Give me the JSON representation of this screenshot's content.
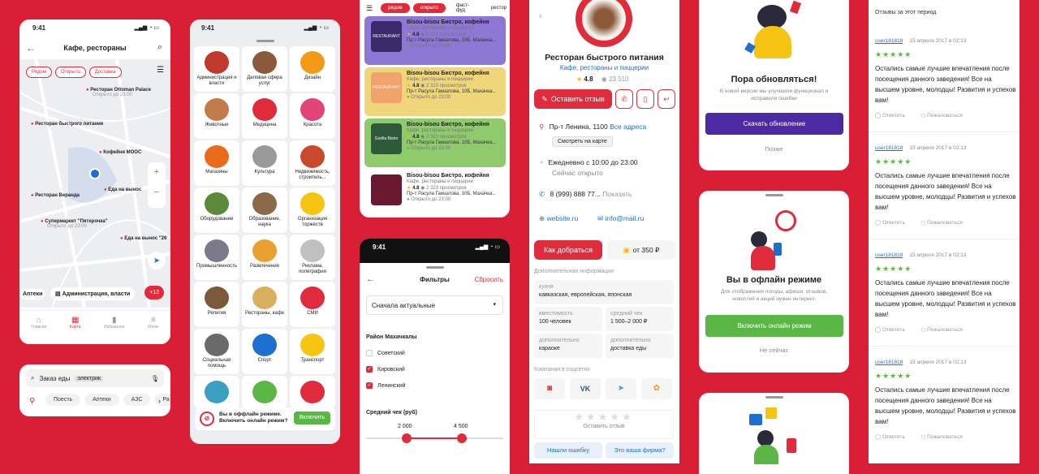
{
  "map": {
    "time": "9:41",
    "title": "Кафе, рестораны",
    "chips": [
      "Рядом",
      "Открыто",
      "Доставка"
    ],
    "pins": [
      {
        "name": "Ресторан Ottoman Palace",
        "sub": "Открыто до 23:00"
      },
      {
        "name": "Ресторан быстрого питания"
      },
      {
        "name": "Кофейня МООС"
      },
      {
        "name": "Еда на вынос"
      },
      {
        "name": "Ресторан Веранда"
      },
      {
        "name": "Супермаркет \"Пятерочка\"",
        "sub": "Открыто до 23:00"
      },
      {
        "name": "Еда на вынос \"26"
      }
    ],
    "bottom_chips": [
      "Аптеки",
      "Администрация, власти",
      "+12"
    ],
    "tabs": [
      "Главная",
      "Карта",
      "Избранное",
      "Меню"
    ]
  },
  "search": {
    "text": "Заказ еды",
    "tag": "электрик",
    "quick": [
      "Поесть",
      "Аптеки",
      "АЗС",
      "Ра"
    ]
  },
  "cats": {
    "time": "9:41",
    "items": [
      "Администрация и власти",
      "Деловая сфера услуг",
      "Дизайн",
      "Животные",
      "Медицина",
      "Красота",
      "Магазины",
      "Культура",
      "Недвижимость, строитель...",
      "Оборудование",
      "Образование, наука",
      "Организация торжеств",
      "Промышленность",
      "Развлечения",
      "Реклама, полиграфия",
      "Религия",
      "Рестораны, кафе",
      "СМИ",
      "Социальная помощь",
      "Спорт",
      "Транспорт"
    ],
    "offline": "Вы в оффлайн режиме. Включить онлайн режим?",
    "offline_btn": "Включить"
  },
  "list": {
    "filters": [
      "рядом",
      "открыто",
      "фаст-фуд",
      "рестор"
    ],
    "items": [
      {
        "title": "Bisou-bisou Бистро, кофейня",
        "sub": "Кафе, рестораны и пиццерии",
        "rating": "4.8",
        "views": "2 323 просмотров",
        "addr": "Пр-т Расула Гамзатова, 10Б, Махачка...",
        "open": "Открыто до 23:00",
        "color": "#8f77d6",
        "logo": "#3a2a6a",
        "logo_text": "RESTAURANT"
      },
      {
        "title": "Bisou-bisou Бистро, кофейня",
        "sub": "Кафе, рестораны и пиццерии",
        "rating": "4.8",
        "views": "2 323 просмотров",
        "addr": "Пр-т Расула Гамзатова, 10Б, Махачка...",
        "open": "Открыто до 23:00",
        "color": "#f0d67a",
        "logo": "#f2a36b",
        "logo_text": "RESTAURANT"
      },
      {
        "title": "Bisou-bisou Бистро, кофейня",
        "sub": "Кафе, рестораны и пиццерии",
        "rating": "4.8",
        "views": "2 323 просмотров",
        "addr": "Пр-т Расула Гамзатова, 10Б, Махачка...",
        "open": "Открыто до 23:00",
        "color": "#8fca6c",
        "logo": "#2f5a3a",
        "logo_text": "Gorilla Bistro"
      },
      {
        "title": "Bisou-bisou Бистро, кофейня",
        "sub": "Кафе, рестораны и пиццерии",
        "rating": "4.8",
        "views": "2 323 просмотров",
        "addr": "Пр-т Расула Гамзатова, 10Б, Махачка...",
        "open": "Открыто до 23:00",
        "color": "#ffffff",
        "logo": "#6a1830",
        "logo_text": ""
      }
    ]
  },
  "filters": {
    "time": "9:41",
    "title": "Фильтры",
    "reset": "Сбросить",
    "sort": "Сначала актуальные",
    "district_label": "Район Махачкалы",
    "districts": [
      {
        "name": "Советский",
        "checked": false
      },
      {
        "name": "Кировский",
        "checked": true
      },
      {
        "name": "Ленинский",
        "checked": true
      }
    ],
    "check_label": "Средний чек (руб)",
    "min": "2 000",
    "max": "4 500"
  },
  "detail": {
    "title": "Ресторан быстрого питания",
    "category": "Кафе, рестораны и пиццерии",
    "rating": "4.8",
    "views": "23 510",
    "review_btn": "Оставить отзыв",
    "address": "Пр-т Ленина, 1100",
    "all_addr": "Все адреса",
    "map_btn": "Смотреть на карте",
    "hours": "Ежедневно с 10:00 до 23:00",
    "open_now": "Сейчас открыто",
    "phone": "8 (999) 888 77...",
    "show": "Показать",
    "site": "website.ru",
    "email": "info@mail.ru",
    "route": "Как добраться",
    "price": "от 350 ₽",
    "add_info": "Дополнительная информация",
    "fields": [
      {
        "k": "кухня",
        "v": "кавказская, европейская, японская"
      },
      {
        "k": "вместимость",
        "v": "100 человек"
      },
      {
        "k": "средний чек",
        "v": "1 500–2 000 ₽"
      },
      {
        "k": "дополнительно",
        "v": "караоке"
      },
      {
        "k": "дополнительно",
        "v": "доставка еды"
      }
    ],
    "social": "Компания в соцсетях",
    "leave_review": "Оставить отзыв",
    "error": "Нашли ошибку",
    "owner": "Это ваша фирма?"
  },
  "update": {
    "title": "Пора обновляться!",
    "text": "В новой версии мы улучшили функционал и исправили ошибки",
    "btn": "Скачать обновление",
    "later": "Позже"
  },
  "offline": {
    "title": "Вы в офлайн режиме",
    "text": "Для отображения погоды, афиши, отзывов, новостей и акций нужен интернет.",
    "btn": "Включить онлайн режим",
    "not_now": "Не сейчас"
  },
  "reviews": {
    "header": "Отзывы за этот период",
    "items": [
      {
        "user": "user181818",
        "date": "15 апреля 2017 в 02:13",
        "text": "Остались самые лучшие впечатления после посещения данного заведения! Все на высшем уровне, молодцы! Развития и успехов вам!"
      },
      {
        "user": "user181818",
        "date": "15 апреля 2017 в 02:13",
        "text": "Остались самые лучшие впечатления после посещения данного заведения! Все на высшем уровне, молодцы! Развития и успехов вам!"
      },
      {
        "user": "user181818",
        "date": "15 апреля 2017 в 02:13",
        "text": "Остались самые лучшие впечатления после посещения данного заведения! Все на высшем уровне, молодцы! Развития и успехов вам!"
      },
      {
        "user": "user181818",
        "date": "15 апреля 2017 в 02:13",
        "text": "Остались самые лучшие впечатления после посещения данного заведения! Все на высшем уровне, молодцы! Развития и успехов вам!"
      }
    ],
    "reply": "Ответить",
    "complain": "Пожаловаться"
  }
}
